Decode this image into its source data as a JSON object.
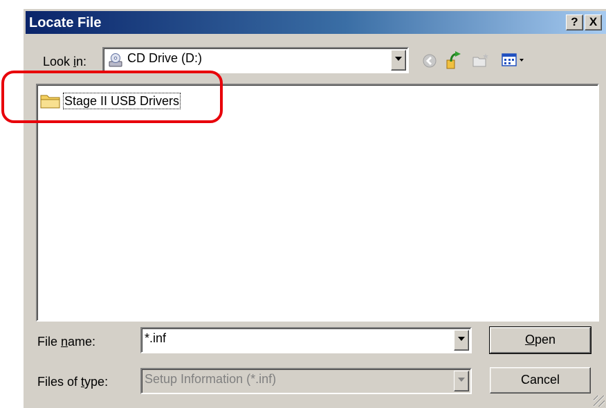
{
  "window": {
    "title": "Locate File",
    "help_label": "?",
    "close_label": "X"
  },
  "look_in": {
    "label_prefix": "Look ",
    "label_accel": "i",
    "label_suffix": "n:",
    "value": "CD Drive (D:)",
    "icon": "cd-drive-icon"
  },
  "toolbar": {
    "icons": [
      "back-icon",
      "up-folder-icon",
      "new-folder-icon",
      "view-menu-icon"
    ]
  },
  "file_list": {
    "items": [
      {
        "name": "Stage II USB Drivers",
        "icon": "folder-icon"
      }
    ]
  },
  "file_name": {
    "label_prefix": "File ",
    "label_accel": "n",
    "label_suffix": "ame:",
    "value": "*.inf"
  },
  "file_type": {
    "label_prefix": "Files of ",
    "label_accel": "t",
    "label_suffix": "ype:",
    "value": "Setup Information (*.inf)"
  },
  "buttons": {
    "open_accel": "O",
    "open_rest": "pen",
    "cancel": "Cancel"
  },
  "colors": {
    "highlight": "#e8000a",
    "title_start": "#0a246a",
    "title_end": "#a6caf0",
    "dialog_face": "#d4d0c8"
  }
}
